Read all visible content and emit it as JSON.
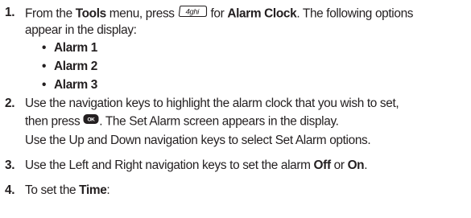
{
  "steps": [
    {
      "number": "1.",
      "line1": {
        "t1": "From the ",
        "b1": "Tools",
        "t2": " menu, press ",
        "key_label": "4ghi",
        "t3": " for ",
        "b2": "Alarm Clock",
        "t4": ". The following options"
      },
      "line2": "appear in the display:",
      "options": [
        "Alarm 1",
        "Alarm 2",
        "Alarm 3"
      ]
    },
    {
      "number": "2.",
      "line1": "Use the navigation keys to highlight the alarm clock that you wish to set,",
      "line2a": "then press ",
      "key_label": "OK",
      "line2b": ". The Set Alarm screen appears in the display.",
      "note": "Use the Up and Down navigation keys to select Set Alarm options."
    },
    {
      "number": "3.",
      "t1": "Use the Left and Right navigation keys to set the alarm ",
      "b1": "Off",
      "t2": " or ",
      "b2": "On",
      "t3": "."
    },
    {
      "number": "4.",
      "t1": "To set the ",
      "b1": "Time",
      "t2": ":"
    }
  ],
  "icons": {
    "key_4": "phone-key-4-icon",
    "key_ok": "ok-key-icon"
  }
}
